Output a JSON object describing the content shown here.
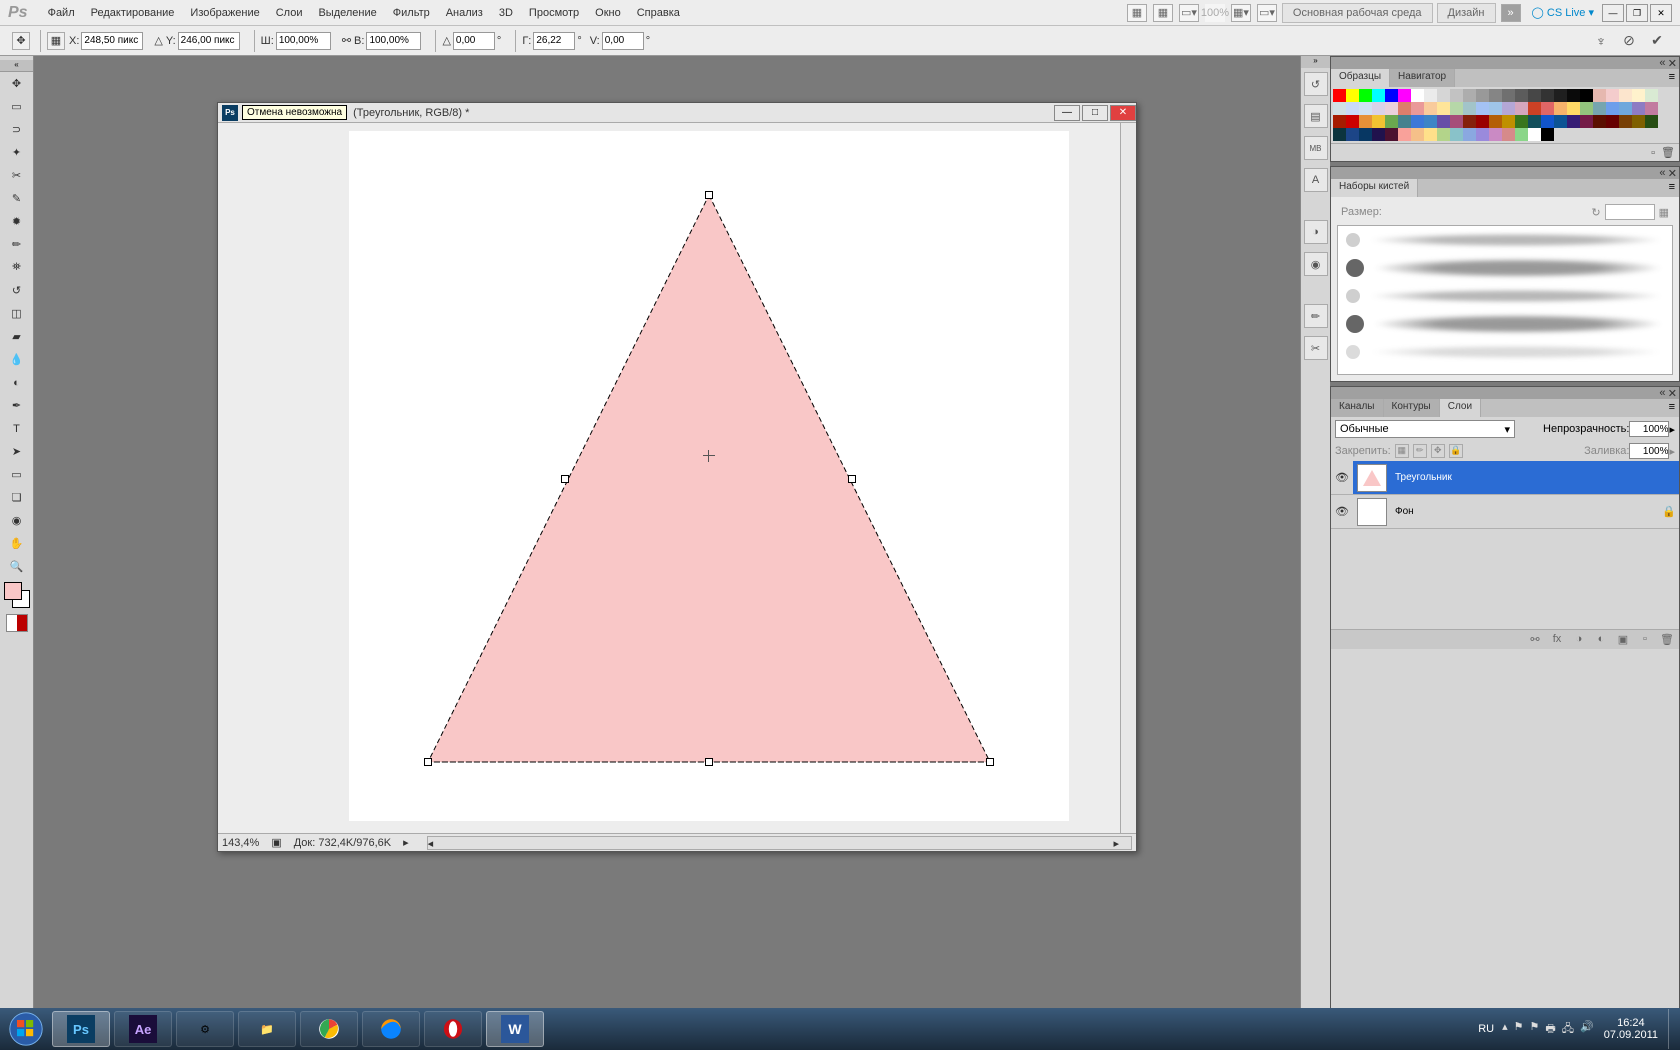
{
  "menu": {
    "items": [
      "Файл",
      "Редактирование",
      "Изображение",
      "Слои",
      "Выделение",
      "Фильтр",
      "Анализ",
      "3D",
      "Просмотр",
      "Окно",
      "Справка"
    ],
    "zoom": "100%",
    "workspace_main": "Основная рабочая среда",
    "workspace_design": "Дизайн",
    "cslive": "CS Live"
  },
  "options": {
    "x_label": "X:",
    "x_val": "248,50 пикс",
    "y_label": "Y:",
    "y_val": "246,00 пикс",
    "w_label": "Ш:",
    "w_val": "100,00%",
    "h_label": "В:",
    "h_val": "100,00%",
    "angle_label": "",
    "angle_val": "0,00",
    "g_label": "Г:",
    "g_val": "26,22",
    "v_label": "V:",
    "v_val": "0,00"
  },
  "document": {
    "tooltip": "Отмена невозможна",
    "title": "(Треугольник, RGB/8) *",
    "zoom": "143,4%",
    "docsize": "Док: 732,4K/976,6K"
  },
  "panels": {
    "swatches_tab": "Образцы",
    "navigator_tab": "Навигатор",
    "brushes_tab": "Наборы кистей",
    "brush_size_label": "Размер:",
    "channels_tab": "Каналы",
    "paths_tab": "Контуры",
    "layers_tab": "Слои",
    "blend_mode": "Обычные",
    "opacity_label": "Непрозрачность:",
    "opacity_val": "100%",
    "lock_label": "Закрепить:",
    "fill_label": "Заливка:",
    "fill_val": "100%",
    "layer1_name": "Треугольник",
    "layer2_name": "Фон"
  },
  "taskbar": {
    "lang": "RU",
    "time": "16:24",
    "date": "07.09.2011"
  },
  "colors": {
    "triangle_fill": "#f9c7c7",
    "swatches": [
      "#ff0000",
      "#ffff00",
      "#00ff00",
      "#00ffff",
      "#0000ff",
      "#ff00ff",
      "#ffffff",
      "#ebebeb",
      "#d6d6d6",
      "#c2c2c2",
      "#adadad",
      "#999999",
      "#858585",
      "#707070",
      "#5c5c5c",
      "#474747",
      "#333333",
      "#1f1f1f",
      "#0a0a0a",
      "#000000",
      "#e6b8af",
      "#f4cccc",
      "#fce5cd",
      "#fff2cc",
      "#d9ead3",
      "#d0e0e3",
      "#c9daf8",
      "#cfe2f3",
      "#d9d2e9",
      "#ead1dc",
      "#dd7e6b",
      "#ea9999",
      "#f9cb9c",
      "#ffe599",
      "#b6d7a8",
      "#a2c4c9",
      "#a4c2f4",
      "#9fc5e8",
      "#b4a7d6",
      "#d5a6bd",
      "#cc4125",
      "#e06666",
      "#f6b26b",
      "#ffd966",
      "#93c47d",
      "#76a5af",
      "#6d9eeb",
      "#6fa8dc",
      "#8e7cc3",
      "#c27ba0",
      "#a61c00",
      "#cc0000",
      "#e69138",
      "#f1c232",
      "#6aa84f",
      "#45818e",
      "#3c78d8",
      "#3d85c6",
      "#674ea7",
      "#a64d79",
      "#85200c",
      "#990000",
      "#b45f06",
      "#bf9000",
      "#38761d",
      "#134f5c",
      "#1155cc",
      "#0b5394",
      "#351c75",
      "#741b47",
      "#5b0f00",
      "#660000",
      "#783f04",
      "#7f6000",
      "#274e13",
      "#0c343d",
      "#1c4587",
      "#073763",
      "#20124d",
      "#4c1130",
      "#f9a19a",
      "#f5c089",
      "#ffe08a",
      "#b3d48a",
      "#89c2c9",
      "#8aa8e0",
      "#9a8adc",
      "#ca8ac4",
      "#d68a8a",
      "#8ad689",
      "#ffffff",
      "#000000"
    ]
  }
}
